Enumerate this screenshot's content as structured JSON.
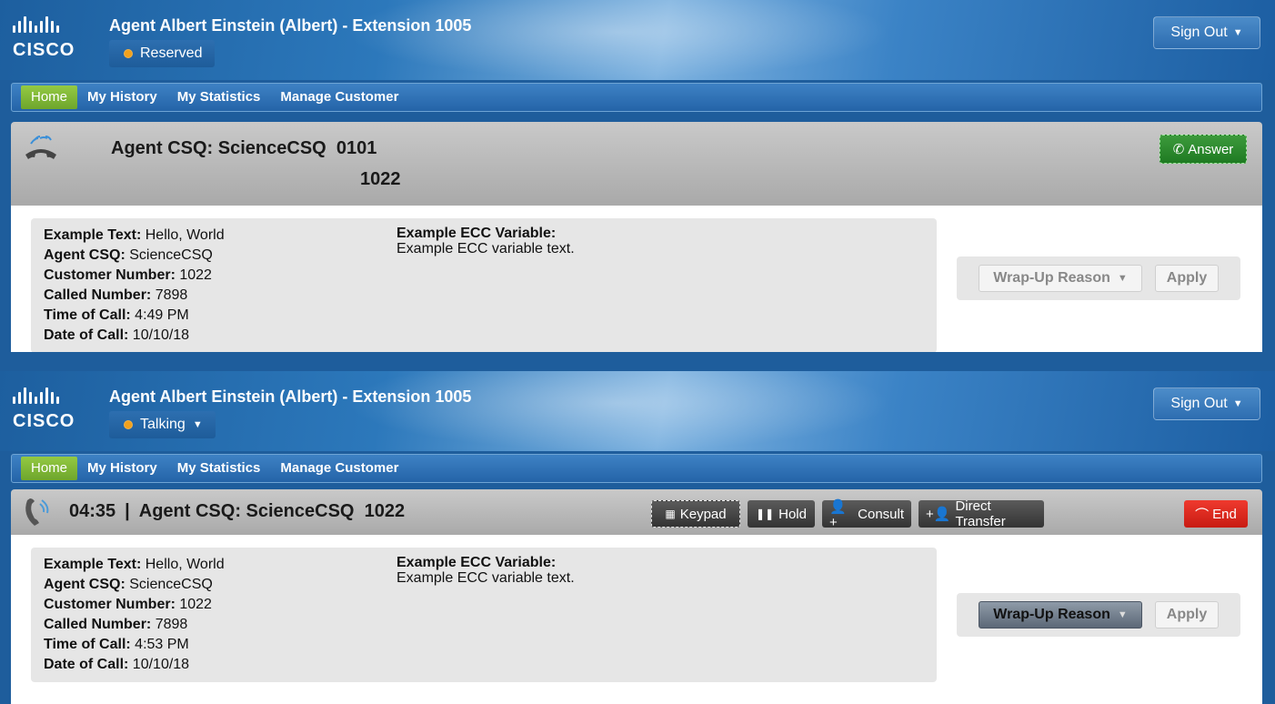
{
  "panels": [
    {
      "header": {
        "logo_text": "CISCO",
        "agent_title": "Agent Albert Einstein (Albert) - Extension 1005",
        "state": "Reserved",
        "signout_label": "Sign Out"
      },
      "nav": [
        "Home",
        "My History",
        "My Statistics",
        "Manage Customer"
      ],
      "call": {
        "title": "Agent CSQ: ScienceCSQ  0101",
        "number": "1022",
        "answer_label": "Answer"
      },
      "info": {
        "example_text_label": "Example Text:",
        "example_text_value": "Hello, World",
        "agent_csq_label": "Agent CSQ:",
        "agent_csq_value": "ScienceCSQ",
        "customer_number_label": "Customer Number:",
        "customer_number_value": "1022",
        "called_number_label": "Called Number:",
        "called_number_value": "7898",
        "time_label": "Time of Call:",
        "time_value": "4:49 PM",
        "date_label": "Date of Call:",
        "date_value": "10/10/18",
        "ecc_label": "Example ECC Variable:",
        "ecc_value": "Example ECC variable text."
      },
      "wrapup": {
        "label": "Wrap-Up Reason",
        "apply_label": "Apply"
      }
    },
    {
      "header": {
        "logo_text": "CISCO",
        "agent_title": "Agent Albert Einstein (Albert) - Extension 1005",
        "state": "Talking",
        "signout_label": "Sign Out"
      },
      "nav": [
        "Home",
        "My History",
        "My Statistics",
        "Manage Customer"
      ],
      "call": {
        "timer": "04:35",
        "separator": "|",
        "title": "Agent CSQ: ScienceCSQ  1022",
        "keypad_label": "Keypad",
        "hold_label": "Hold",
        "consult_label": "Consult",
        "transfer_label": "Direct Transfer",
        "end_label": "End"
      },
      "info": {
        "example_text_label": "Example Text:",
        "example_text_value": "Hello, World",
        "agent_csq_label": "Agent CSQ:",
        "agent_csq_value": "ScienceCSQ",
        "customer_number_label": "Customer Number:",
        "customer_number_value": "1022",
        "called_number_label": "Called Number:",
        "called_number_value": "7898",
        "time_label": "Time of Call:",
        "time_value": "4:53 PM",
        "date_label": "Date of Call:",
        "date_value": "10/10/18",
        "ecc_label": "Example ECC Variable:",
        "ecc_value": "Example ECC variable text."
      },
      "wrapup": {
        "label": "Wrap-Up Reason",
        "apply_label": "Apply"
      }
    }
  ],
  "colors": {
    "brand_blue": "#1e5d9c",
    "nav_active": "#80b838",
    "answer_green": "#2a8a2c",
    "end_red": "#dc2a1f",
    "state_dot": "#f2a11c"
  },
  "icons": [
    "cisco-logo",
    "phone-ringing-icon",
    "phone-icon",
    "keypad-icon",
    "hold-icon",
    "consult-icon",
    "transfer-icon",
    "end-call-icon",
    "caret-down-icon"
  ]
}
